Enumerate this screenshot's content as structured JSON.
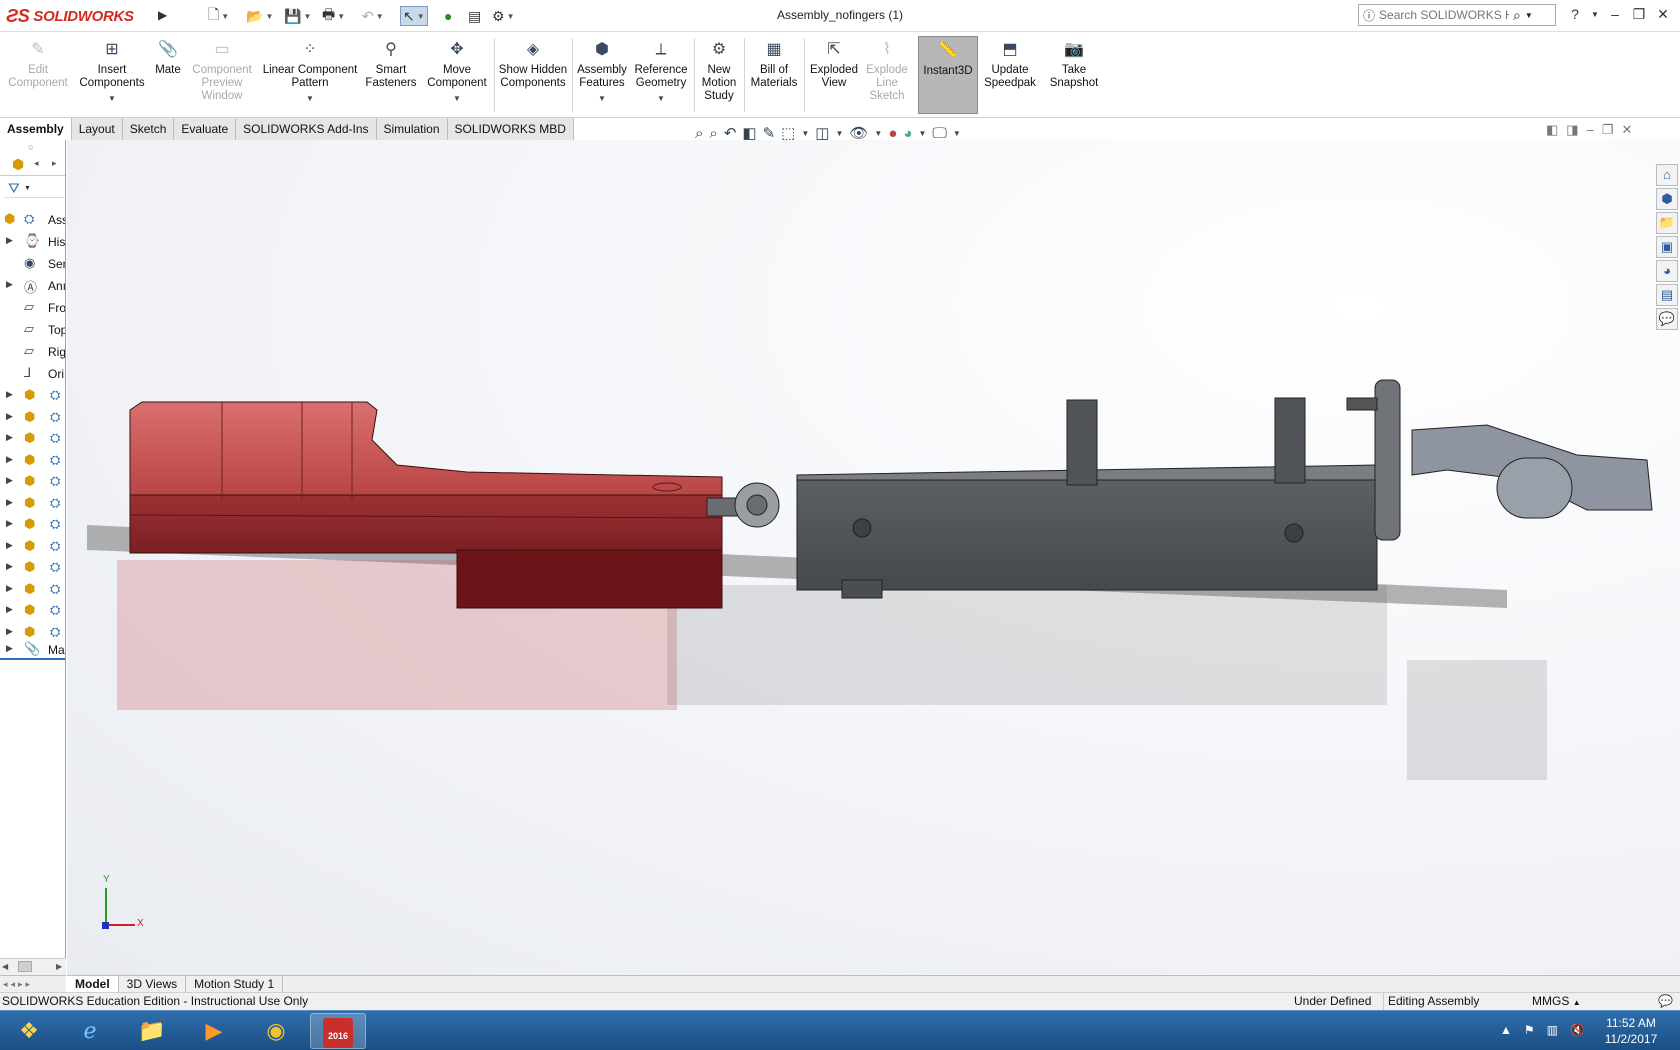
{
  "app": {
    "logo_text": "SOLIDWORKS",
    "document_title": "Assembly_nofingers (1)"
  },
  "search": {
    "placeholder": "Search SOLIDWORKS Help"
  },
  "commands": [
    {
      "label": "Edit Component",
      "state": "disabled"
    },
    {
      "label": "Insert Components",
      "state": "enabled"
    },
    {
      "label": "Mate",
      "state": "enabled"
    },
    {
      "label": "Component Preview Window",
      "state": "disabled"
    },
    {
      "label": "Linear Component Pattern",
      "state": "enabled"
    },
    {
      "label": "Smart Fasteners",
      "state": "enabled"
    },
    {
      "label": "Move Component",
      "state": "enabled"
    },
    {
      "label": "Show Hidden Components",
      "state": "enabled"
    },
    {
      "label": "Assembly Features",
      "state": "enabled"
    },
    {
      "label": "Reference Geometry",
      "state": "enabled"
    },
    {
      "label": "New Motion Study",
      "state": "enabled"
    },
    {
      "label": "Bill of Materials",
      "state": "enabled"
    },
    {
      "label": "Exploded View",
      "state": "enabled"
    },
    {
      "label": "Explode Line Sketch",
      "state": "disabled"
    },
    {
      "label": "Instant3D",
      "state": "pressed"
    },
    {
      "label": "Update Speedpak",
      "state": "enabled"
    },
    {
      "label": "Take Snapshot",
      "state": "enabled"
    }
  ],
  "tabs": [
    "Assembly",
    "Layout",
    "Sketch",
    "Evaluate",
    "SOLIDWORKS Add-Ins",
    "Simulation",
    "SOLIDWORKS MBD"
  ],
  "tree": [
    {
      "label": "Ass"
    },
    {
      "label": "His"
    },
    {
      "label": "Ser"
    },
    {
      "label": "Anı"
    },
    {
      "label": "Fro"
    },
    {
      "label": "Top"
    },
    {
      "label": "Rig"
    },
    {
      "label": "Ori"
    },
    {
      "label": "Ma"
    }
  ],
  "bottom_tabs": [
    "Model",
    "3D Views",
    "Motion Study 1"
  ],
  "status": {
    "left": "SOLIDWORKS Education Edition - Instructional Use Only",
    "definition": "Under Defined",
    "mode": "Editing Assembly",
    "units": "MMGS"
  },
  "triad": {
    "x": "X",
    "y": "Y"
  },
  "taskbar": {
    "time": "11:52 AM",
    "date": "11/2/2017",
    "sw_badge": "2016"
  },
  "colors": {
    "brand": "#d52b1e",
    "red_part": "#b83a3c",
    "gray_part": "#4f5357"
  }
}
